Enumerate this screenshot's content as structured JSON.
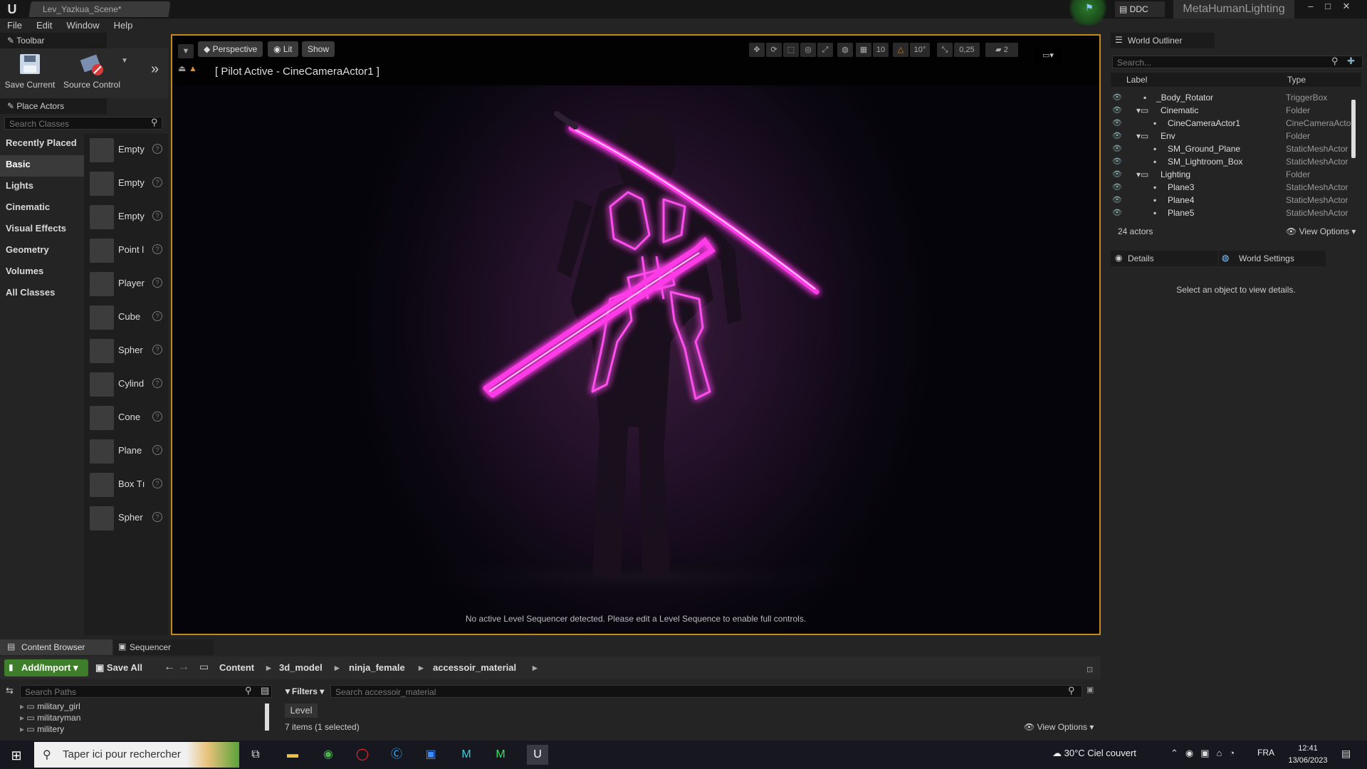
{
  "window": {
    "level_tab": "Lev_Yazkua_Scene*",
    "ddc": "DDC",
    "project_name": "MetaHumanLighting",
    "controls": [
      "–",
      "□",
      "✕"
    ]
  },
  "menu": [
    "File",
    "Edit",
    "Window",
    "Help"
  ],
  "toolbar": {
    "tab_label": "Toolbar",
    "save_current": "Save Current",
    "source_control": "Source Control"
  },
  "place_actors": {
    "tab_label": "Place Actors",
    "search_placeholder": "Search Classes",
    "categories": [
      "Recently Placed",
      "Basic",
      "Lights",
      "Cinematic",
      "Visual Effects",
      "Geometry",
      "Volumes",
      "All Classes"
    ],
    "active_category": "Basic",
    "items": [
      "Empty",
      "Empty",
      "Empty",
      "Point l",
      "Player",
      "Cube",
      "Spher",
      "Cylind",
      "Cone",
      "Plane",
      "Box Tı",
      "Spher"
    ]
  },
  "viewport": {
    "perspective": "Perspective",
    "lit": "Lit",
    "show": "Show",
    "grid_snap": "10",
    "rotation_snap": "10°",
    "scale_snap": "0,25",
    "camera_speed": "2",
    "pilot_text": "[ Pilot Active - CineCameraActor1 ]",
    "message": "No active Level Sequencer detected. Please edit a Level Sequence to enable full controls."
  },
  "outliner": {
    "tab_label": "World Outliner",
    "search_placeholder": "Search...",
    "col_label": "Label",
    "col_type": "Type",
    "rows": [
      {
        "label": "_Body_Rotator",
        "type": "TriggerBox",
        "indent": 2
      },
      {
        "label": "Cinematic",
        "type": "Folder",
        "indent": 1
      },
      {
        "label": "CineCameraActor1",
        "type": "CineCameraActo",
        "indent": 2
      },
      {
        "label": "Env",
        "type": "Folder",
        "indent": 1
      },
      {
        "label": "SM_Ground_Plane",
        "type": "StaticMeshActor",
        "indent": 2
      },
      {
        "label": "SM_Lightroom_Box",
        "type": "StaticMeshActor",
        "indent": 2
      },
      {
        "label": "Lighting",
        "type": "Folder",
        "indent": 1
      },
      {
        "label": "Plane3",
        "type": "StaticMeshActor",
        "indent": 2
      },
      {
        "label": "Plane4",
        "type": "StaticMeshActor",
        "indent": 2
      },
      {
        "label": "Plane5",
        "type": "StaticMeshActor",
        "indent": 2
      }
    ],
    "actor_count": "24 actors",
    "view_options": "View Options"
  },
  "details": {
    "tab_label": "Details",
    "world_settings_label": "World Settings",
    "message": "Select an object to view details."
  },
  "content_browser": {
    "tab_label": "Content Browser",
    "sequencer_label": "Sequencer",
    "add_import": "Add/Import",
    "save_all": "Save All",
    "breadcrumbs": [
      "Content",
      "3d_model",
      "ninja_female",
      "accessoir_material"
    ],
    "search_paths_placeholder": "Search Paths",
    "filters": "Filters",
    "search_assets_placeholder": "Search accessoir_material",
    "folders": [
      "military_girl",
      "militaryman",
      "militery"
    ],
    "level_chip": "Level",
    "items_count": "7 items (1 selected)",
    "view_options": "View Options"
  },
  "taskbar": {
    "search_placeholder": "Taper ici pour rechercher",
    "weather": "30°C  Ciel couvert",
    "language": "FRA",
    "time": "12:41",
    "date": "13/06/2023"
  }
}
